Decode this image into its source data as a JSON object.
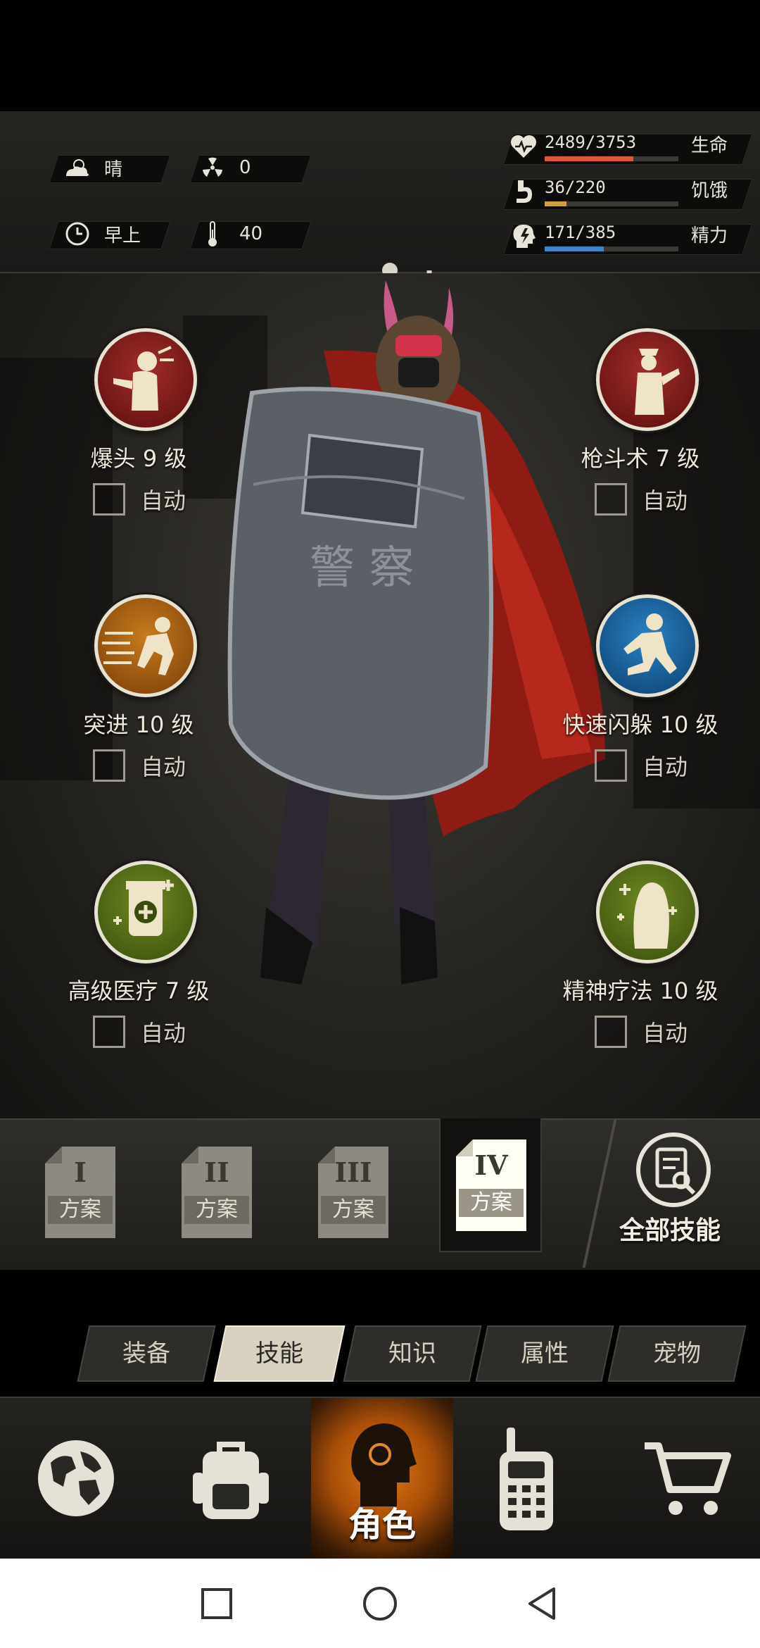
{
  "status": {
    "weather": "晴",
    "radiation": "0",
    "time_of_day": "早上",
    "temperature": "40",
    "health": {
      "value": "2489/3753",
      "label": "生命",
      "fraction": 0.663,
      "color": "#d8573d"
    },
    "hunger": {
      "value": "36/220",
      "label": "饥饿",
      "fraction": 0.164,
      "color": "#c9a23d"
    },
    "energy": {
      "value": "171/385",
      "label": "精力",
      "fraction": 0.444,
      "color": "#3f85c7"
    }
  },
  "skills": [
    {
      "name": "爆头 9 级",
      "auto": "自动",
      "checked": false,
      "icon": "headshot-icon"
    },
    {
      "name": "枪斗术 7 级",
      "auto": "自动",
      "checked": false,
      "icon": "gun-kata-icon"
    },
    {
      "name": "突进 10 级",
      "auto": "自动",
      "checked": false,
      "icon": "dash-icon"
    },
    {
      "name": "快速闪躲 10 级",
      "auto": "自动",
      "checked": false,
      "icon": "quick-dodge-icon"
    },
    {
      "name": "高级医疗 7 级",
      "auto": "自动",
      "checked": false,
      "icon": "advanced-medical-icon"
    },
    {
      "name": "精神疗法 10 级",
      "auto": "自动",
      "checked": false,
      "icon": "psychotherapy-icon"
    }
  ],
  "plans": [
    {
      "numeral": "I",
      "label": "方案"
    },
    {
      "numeral": "II",
      "label": "方案"
    },
    {
      "numeral": "III",
      "label": "方案"
    },
    {
      "numeral": "IV",
      "label": "方案"
    }
  ],
  "all_skills_label": "全部技能",
  "tabs": [
    "装备",
    "技能",
    "知识",
    "属性",
    "宠物"
  ],
  "active_tab": "技能",
  "nav": {
    "active_label": "角色",
    "items": [
      "globe-icon",
      "backpack-icon",
      "character-icon",
      "radio-icon",
      "cart-icon"
    ]
  }
}
